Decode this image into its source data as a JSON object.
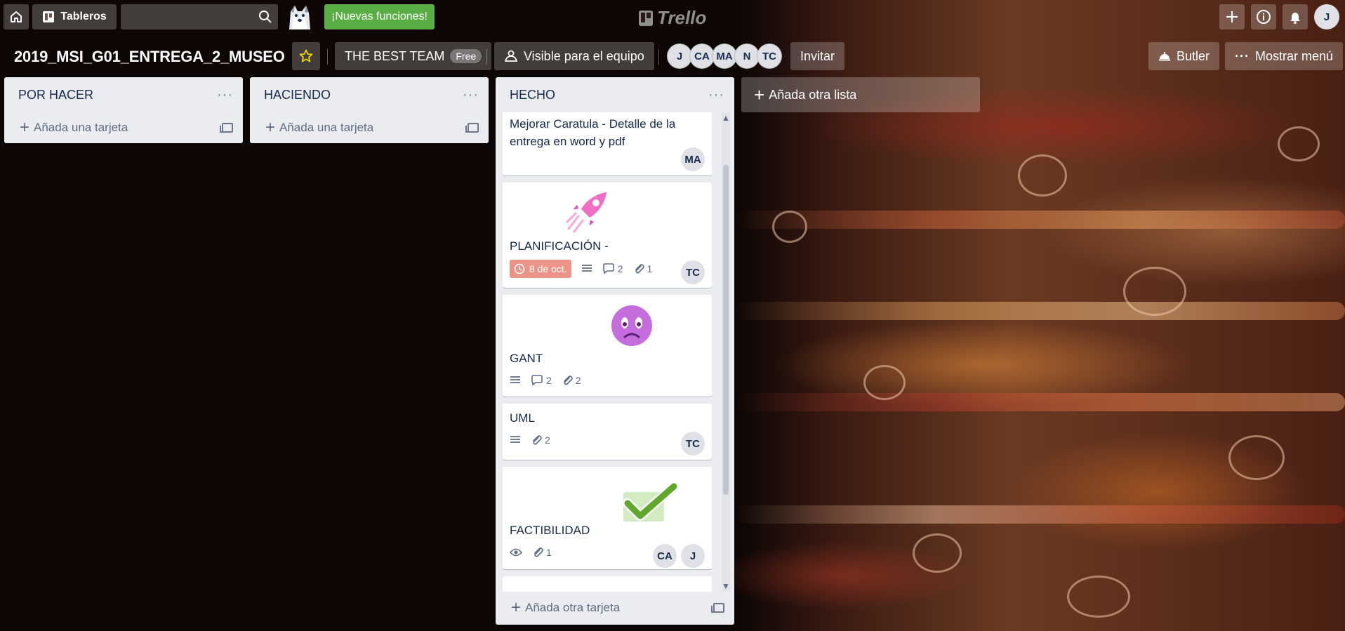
{
  "header": {
    "boards_label": "Tableros",
    "search_value": "",
    "new_features_label": "¡Nuevas funciones!",
    "logo_text": "Trello",
    "user_initial": "J"
  },
  "board": {
    "title": "2019_MSI_G01_ENTREGA_2_MUSEO",
    "team_label": "THE BEST TEAM",
    "team_plan": "Free",
    "visibility_label": "Visible para el equipo",
    "members": [
      "J",
      "CA",
      "MA",
      "N",
      "TC"
    ],
    "invite_label": "Invitar",
    "butler_label": "Butler",
    "show_menu_label": "Mostrar menú"
  },
  "lists": {
    "todo": {
      "name": "POR HACER",
      "add_card_label": "Añada una tarjeta"
    },
    "doing": {
      "name": "HACIENDO",
      "add_card_label": "Añada una tarjeta"
    },
    "done": {
      "name": "HECHO",
      "add_card_label": "Añada otra tarjeta",
      "cards": [
        {
          "title_line1": "Mejorar Caratula - Detalle de la",
          "title_line2": "entrega en word y pdf",
          "members": [
            "MA"
          ]
        },
        {
          "title": "PLANIFICACIÓN -",
          "sticker": "rocket-sticker",
          "due": "8 de oct.",
          "comments": "2",
          "attachments": "1",
          "members": [
            "TC"
          ]
        },
        {
          "title": "GANT",
          "sticker": "worried-face-sticker",
          "comments": "2",
          "attachments": "2"
        },
        {
          "title": "UML",
          "attachments": "2",
          "members": [
            "TC"
          ]
        },
        {
          "title": "FACTIBILIDAD",
          "sticker": "checkmark-sticker",
          "attachments": "1",
          "members": [
            "CA",
            "J"
          ]
        }
      ]
    }
  },
  "add_list_label": "Añada otra lista",
  "colors": {
    "new_features": "#5aac44",
    "due_badge": "#ec9488",
    "list_bg": "#ebecf0"
  }
}
